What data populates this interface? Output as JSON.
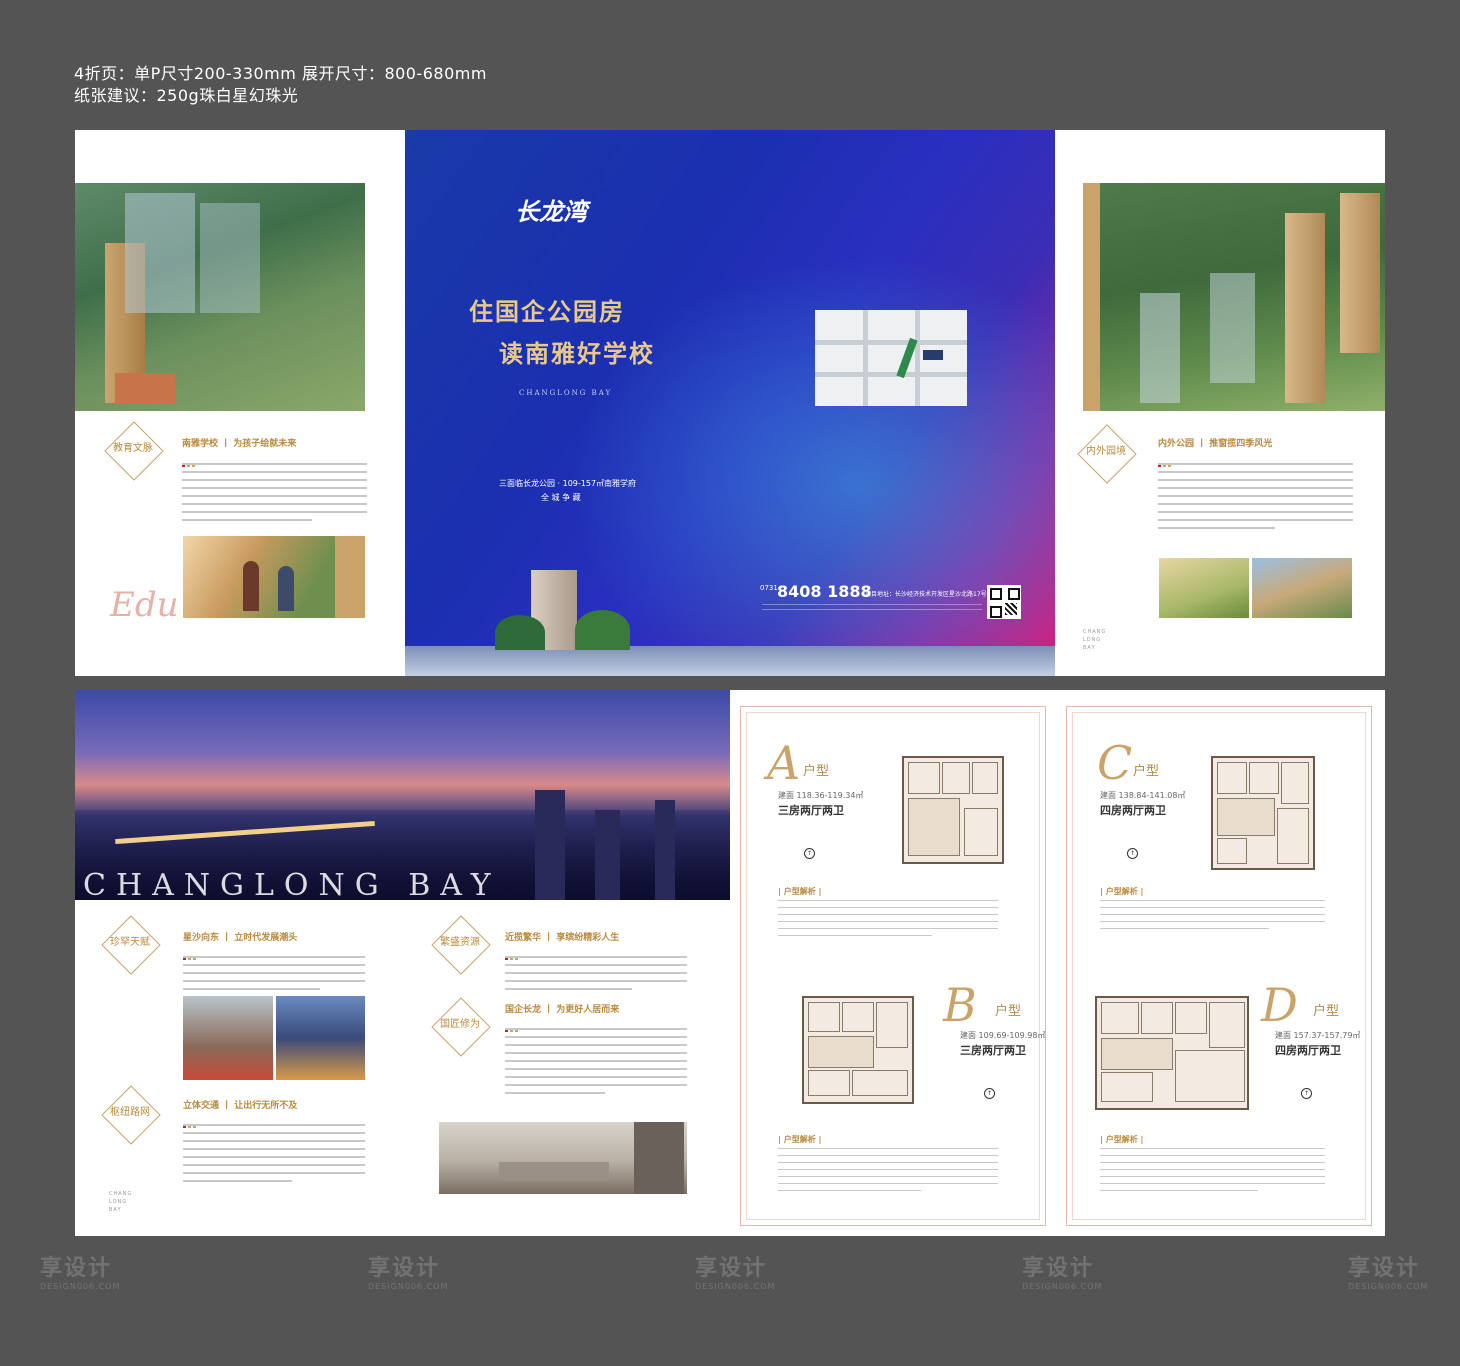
{
  "spec": {
    "line1": "4折页：单P尺寸200-330mm 展开尺寸：800-680mm",
    "line2": "纸张建议：250g珠白星幻珠光"
  },
  "watermark": {
    "cn": "享设计",
    "en": "DESIGN006.COM"
  },
  "cover": {
    "logo": "长龙湾",
    "slogan1": "住国企公园房",
    "slogan2": "读南雅好学校",
    "subtitle": "CHANGLONG BAY",
    "tagline": "三面临长龙公园 · 109-157㎡南雅学府",
    "tagline2": "全 城 争 藏",
    "phone": "8408 1888",
    "phone_prefix": "0731",
    "address": "项目地址：长沙经济技术开发区星沙北路17号"
  },
  "left_panel": {
    "hex": "教育文脉",
    "title": "南雅学校 丨 为孩子绘就未来",
    "script": "Edu"
  },
  "right_panel": {
    "hex": "内外园境",
    "title": "内外公园 丨 推窗揽四季风光",
    "vertical": "CHANG LONG BAY"
  },
  "bottom_left": {
    "banner": "CHANGLONG BAY",
    "hex1": "珍罕天赋",
    "title1": "星沙向东 丨 立时代发展潮头",
    "hex2": "繁盛资源",
    "title2": "近揽繁华 丨 享缤纷精彩人生",
    "hex3": "国匠修为",
    "title3": "国企长龙 丨 为更好人居而来",
    "hex4": "枢纽路网",
    "title4": "立体交通 丨 让出行无所不及",
    "vertical": "CHANG LONG BAY"
  },
  "plans": [
    {
      "letter": "A",
      "type": "户型",
      "area": "建面 118.36-119.34㎡",
      "rooms": "三房两厅两卫",
      "analysis": "| 户型解析 |"
    },
    {
      "letter": "C",
      "type": "户型",
      "area": "建面 138.84-141.08㎡",
      "rooms": "四房两厅两卫",
      "analysis": "| 户型解析 |"
    },
    {
      "letter": "B",
      "type": "户型",
      "area": "建面 109.69-109.98㎡",
      "rooms": "三房两厅两卫",
      "analysis": "| 户型解析 |"
    },
    {
      "letter": "D",
      "type": "户型",
      "area": "建面 157.37-157.79㎡",
      "rooms": "四房两厅两卫",
      "analysis": "| 户型解析 |"
    }
  ],
  "colors": {
    "gold": "#b88a3e",
    "cover_blue": "#1d2fb8",
    "cover_pink": "#d0206e"
  }
}
